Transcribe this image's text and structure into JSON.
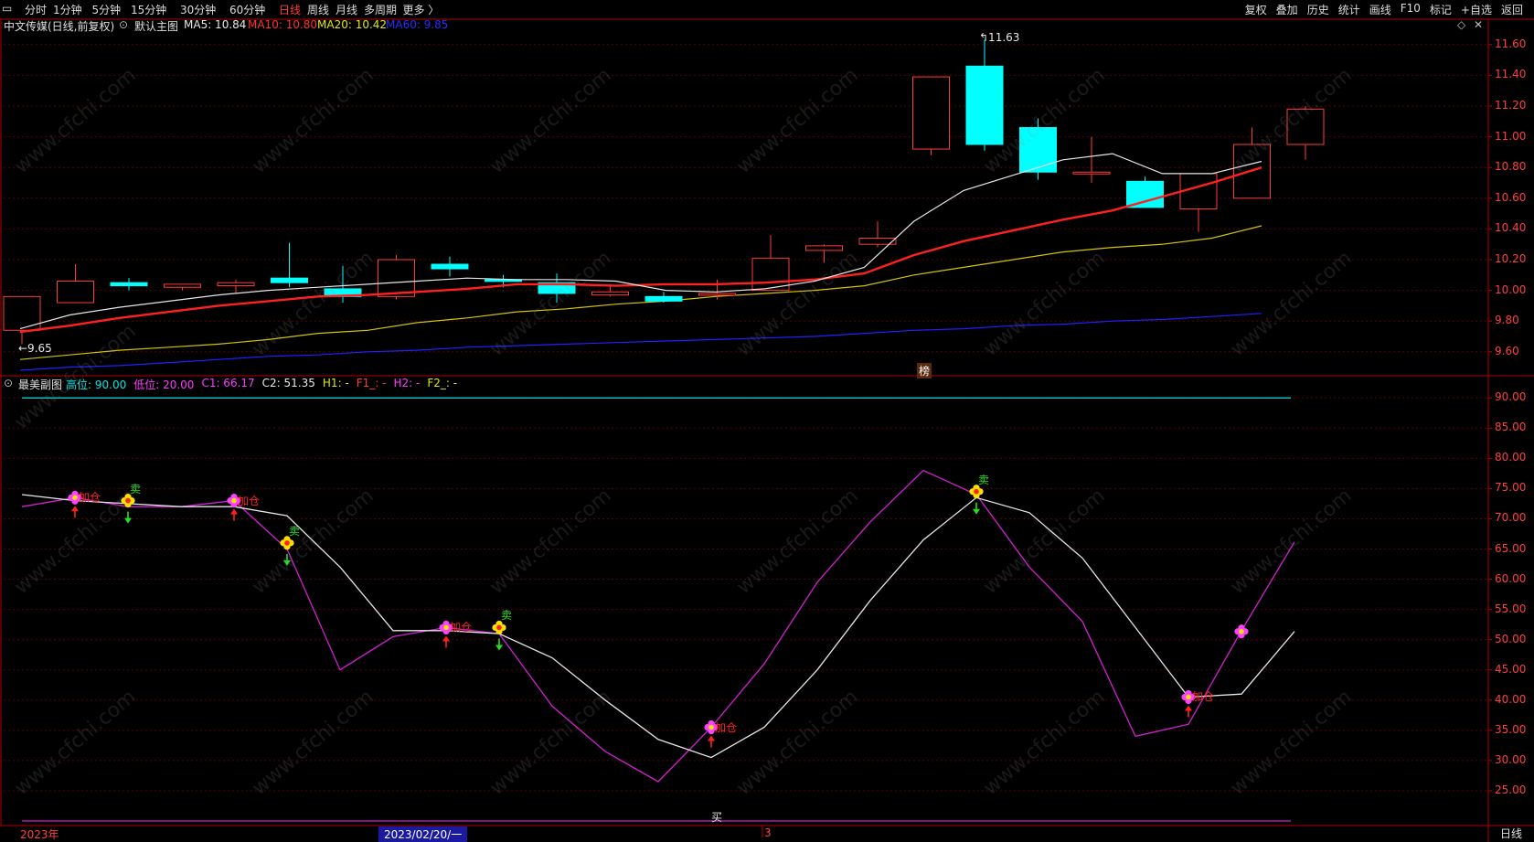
{
  "toolbar": {
    "menu_icon": "window-icon",
    "items": [
      {
        "label": "分时",
        "active": false
      },
      {
        "label": "1分钟",
        "active": false
      },
      {
        "label": "5分钟",
        "active": false
      },
      {
        "label": "15分钟",
        "active": false
      },
      {
        "label": "30分钟",
        "active": false
      },
      {
        "label": "60分钟",
        "active": false
      },
      {
        "label": "日线",
        "active": true
      },
      {
        "label": "周线",
        "active": false
      },
      {
        "label": "月线",
        "active": false
      },
      {
        "label": "多周期",
        "active": false
      },
      {
        "label": "更多 〉",
        "active": false
      }
    ],
    "right_items": [
      "复权",
      "叠加",
      "历史",
      "统计",
      "画线",
      "F10",
      "标记",
      "+自选",
      "返回"
    ]
  },
  "main_chart": {
    "title": "中文传媒(日线,前复权)",
    "indicator_name": "默认主图",
    "ma5_label": "MA5: 10.84",
    "ma10_label": "MA10: 10.80",
    "ma20_label": "MA20: 10.42",
    "ma60_label": "MA60: 9.85",
    "high_mark": "11.63",
    "low_mark": "←9.65",
    "badge": "榜",
    "y_ticks": [
      "11.60",
      "11.40",
      "11.20",
      "11.00",
      "10.80",
      "10.60",
      "10.40",
      "10.20",
      "10.00",
      "9.80",
      "9.60"
    ]
  },
  "sub_chart": {
    "name": "最美副图",
    "params": [
      {
        "label": "高位: 90.00",
        "color": "#00e5e5"
      },
      {
        "label": "低位: 20.00",
        "color": "#ff3bff"
      },
      {
        "label": "C1: 66.17",
        "color": "#ff3bff"
      },
      {
        "label": "C2: 51.35",
        "color": "#e6e6e6"
      },
      {
        "label": "H1: -",
        "color": "#e6e600"
      },
      {
        "label": "F1_: -",
        "color": "#ff3b3b"
      },
      {
        "label": "H2: -",
        "color": "#ff3bff"
      },
      {
        "label": "F2_: -",
        "color": "#e6e600"
      }
    ],
    "y_ticks": [
      "90.00",
      "85.00",
      "80.00",
      "75.00",
      "70.00",
      "65.00",
      "60.00",
      "55.00",
      "50.00",
      "45.00",
      "40.00",
      "35.00",
      "30.00",
      "25.00"
    ],
    "buy_label": "买",
    "add_label": "加仓",
    "sell_label": "卖"
  },
  "footer": {
    "year_label": "2023年",
    "date_label": "2023/02/20/一",
    "month_label": "3",
    "period_label": "日线"
  },
  "watermark": "www.cfchi.com",
  "colors": {
    "up": "#ff3b3b",
    "down": "#00ffff",
    "ma5": "#e6e6e6",
    "ma10": "#ff2020",
    "ma20": "#d4c400",
    "ma60": "#2020ff",
    "grid": "#5a0000",
    "axis": "#b30000",
    "c1": "#d020d0",
    "c2": "#e6e6e6"
  },
  "chart_data": [
    {
      "type": "candlestick",
      "title": "中文传媒(日线,前复权)",
      "ylim": [
        9.45,
        11.7
      ],
      "candles": [
        {
          "o": 9.74,
          "h": 9.96,
          "l": 9.65,
          "c": 9.96
        },
        {
          "o": 9.92,
          "h": 10.17,
          "l": 9.92,
          "c": 10.06
        },
        {
          "o": 10.05,
          "h": 10.08,
          "l": 10.0,
          "c": 10.03
        },
        {
          "o": 10.02,
          "h": 10.04,
          "l": 10.0,
          "c": 10.04
        },
        {
          "o": 10.03,
          "h": 10.07,
          "l": 9.98,
          "c": 10.05
        },
        {
          "o": 10.08,
          "h": 10.31,
          "l": 10.02,
          "c": 10.05
        },
        {
          "o": 10.01,
          "h": 10.16,
          "l": 9.92,
          "c": 9.96
        },
        {
          "o": 9.96,
          "h": 10.23,
          "l": 9.94,
          "c": 10.2
        },
        {
          "o": 10.17,
          "h": 10.22,
          "l": 10.09,
          "c": 10.14
        },
        {
          "o": 10.07,
          "h": 10.1,
          "l": 10.02,
          "c": 10.06
        },
        {
          "o": 10.05,
          "h": 10.11,
          "l": 9.92,
          "c": 9.98
        },
        {
          "o": 9.97,
          "h": 10.04,
          "l": 9.96,
          "c": 9.99
        },
        {
          "o": 9.96,
          "h": 9.99,
          "l": 9.92,
          "c": 9.93
        },
        {
          "o": 9.97,
          "h": 10.07,
          "l": 9.94,
          "c": 9.98
        },
        {
          "o": 10.0,
          "h": 10.36,
          "l": 10.0,
          "c": 10.21
        },
        {
          "o": 10.26,
          "h": 10.3,
          "l": 10.18,
          "c": 10.29
        },
        {
          "o": 10.3,
          "h": 10.45,
          "l": 10.28,
          "c": 10.34
        },
        {
          "o": 10.92,
          "h": 11.39,
          "l": 10.88,
          "c": 11.39
        },
        {
          "o": 11.46,
          "h": 11.63,
          "l": 10.91,
          "c": 10.95
        },
        {
          "o": 11.06,
          "h": 11.12,
          "l": 10.72,
          "c": 10.77
        },
        {
          "o": 10.77,
          "h": 11.0,
          "l": 10.7,
          "c": 10.77
        },
        {
          "o": 10.71,
          "h": 10.74,
          "l": 10.54,
          "c": 10.54
        },
        {
          "o": 10.53,
          "h": 10.76,
          "l": 10.38,
          "c": 10.76
        },
        {
          "o": 10.6,
          "h": 11.06,
          "l": 10.6,
          "c": 10.95
        },
        {
          "o": 10.95,
          "h": 11.2,
          "l": 10.85,
          "c": 11.18
        }
      ],
      "ma5": [
        9.75,
        9.84,
        9.89,
        9.93,
        9.97,
        10.0,
        10.02,
        10.04,
        10.06,
        10.08,
        10.07,
        10.07,
        10.06,
        10.0,
        9.99,
        10.01,
        10.06,
        10.15,
        10.45,
        10.65,
        10.75,
        10.85,
        10.89,
        10.76,
        10.76,
        10.84
      ],
      "ma10": [
        9.73,
        9.77,
        9.82,
        9.86,
        9.9,
        9.93,
        9.96,
        9.97,
        9.99,
        10.01,
        10.04,
        10.04,
        10.03,
        10.04,
        10.04,
        10.05,
        10.07,
        10.11,
        10.23,
        10.32,
        10.39,
        10.46,
        10.52,
        10.61,
        10.7,
        10.8
      ],
      "ma20": [
        9.55,
        9.58,
        9.61,
        9.63,
        9.65,
        9.68,
        9.72,
        9.74,
        9.79,
        9.82,
        9.86,
        9.88,
        9.91,
        9.93,
        9.96,
        9.98,
        10.0,
        10.03,
        10.1,
        10.15,
        10.2,
        10.25,
        10.28,
        10.3,
        10.34,
        10.42
      ],
      "ma60": [
        9.48,
        9.5,
        9.51,
        9.53,
        9.55,
        9.57,
        9.58,
        9.6,
        9.61,
        9.63,
        9.64,
        9.65,
        9.66,
        9.67,
        9.68,
        9.69,
        9.7,
        9.72,
        9.74,
        9.75,
        9.77,
        9.78,
        9.8,
        9.81,
        9.83,
        9.85
      ]
    },
    {
      "type": "line",
      "title": "最美副图",
      "ylim": [
        20,
        92
      ],
      "series": [
        {
          "name": "C1",
          "values": [
            72,
            73.5,
            72,
            72,
            73,
            65,
            45,
            50.5,
            52,
            51,
            39,
            31.5,
            26.5,
            35.5,
            46,
            59.5,
            69.5,
            78,
            74,
            62,
            53,
            34,
            36,
            51.5,
            66.17
          ]
        },
        {
          "name": "C2",
          "values": [
            74,
            73,
            72.5,
            72,
            72,
            70.5,
            62,
            51.5,
            51.5,
            51,
            47,
            40,
            33.5,
            30.5,
            35.5,
            45,
            56.5,
            66.5,
            73.5,
            71,
            63.5,
            52,
            40.5,
            41,
            51.35
          ]
        }
      ],
      "reference_lines": [
        90,
        20
      ]
    }
  ]
}
